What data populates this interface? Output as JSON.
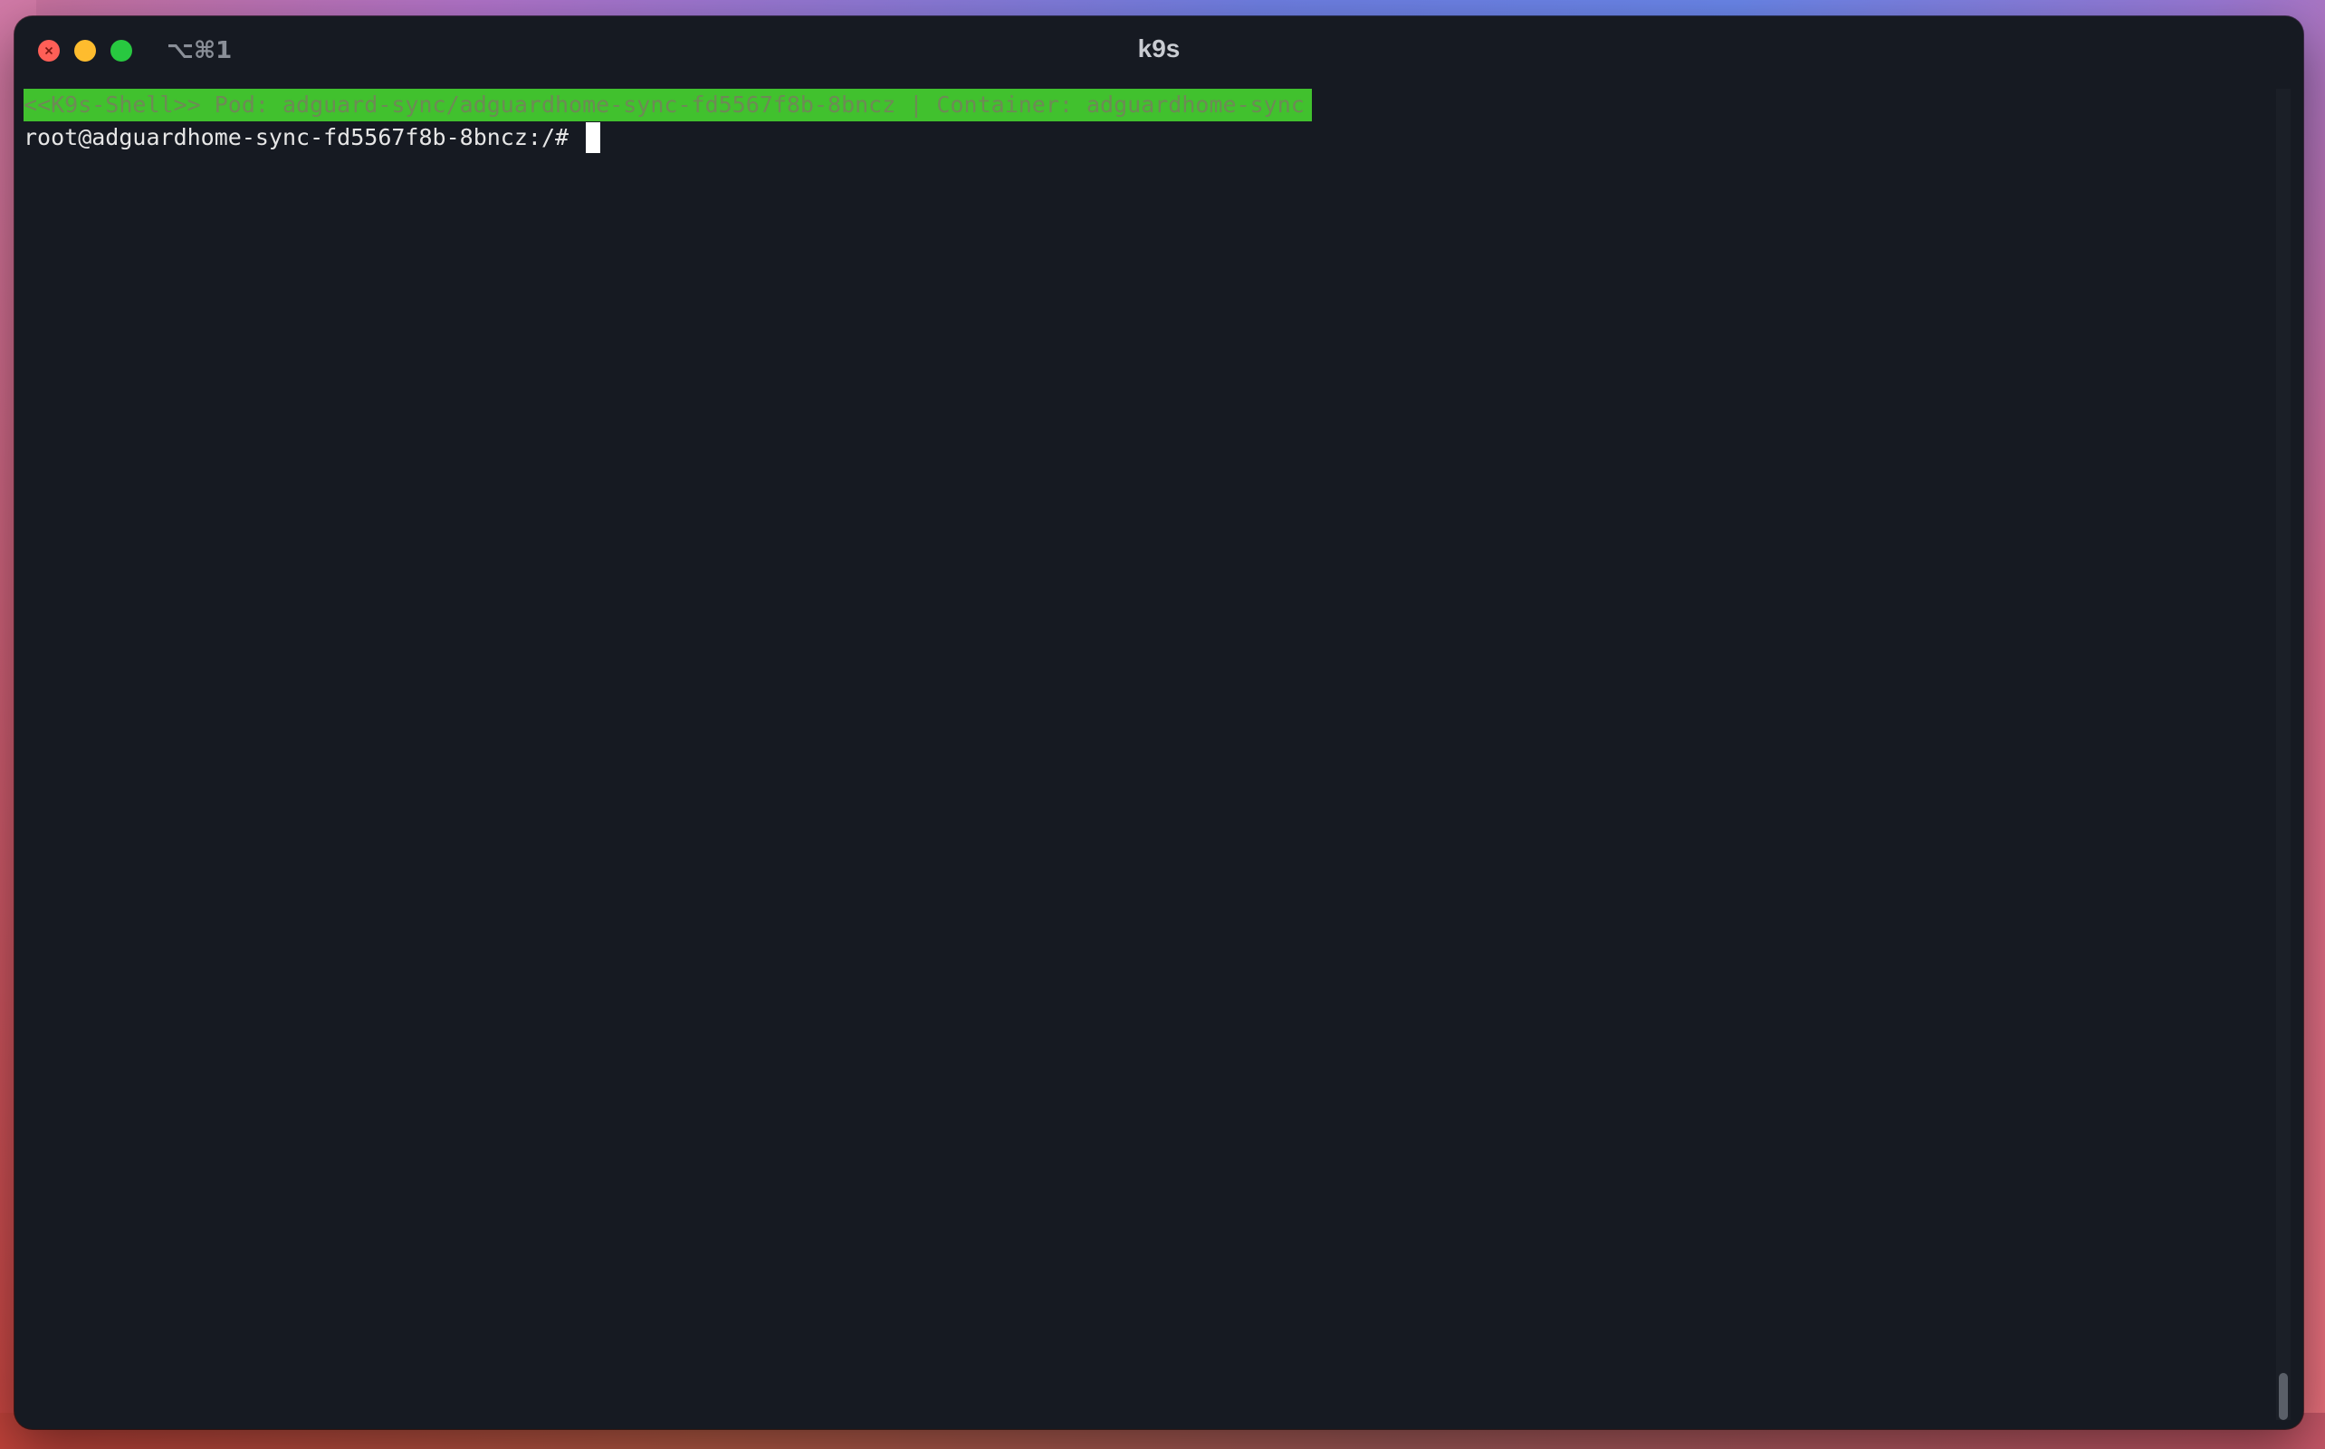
{
  "window": {
    "shortcut": "⌥⌘1",
    "title": "k9s"
  },
  "terminal": {
    "banner": "<<K9s-Shell>> Pod: adguard-sync/adguardhome-sync-fd5567f8b-8bncz | Container: adguardhome-sync",
    "prompt": "root@adguardhome-sync-fd5567f8b-8bncz:/# "
  },
  "colors": {
    "banner_bg": "#41c12e",
    "terminal_bg": "#161a22",
    "close": "#ff5f57",
    "minimize": "#febc2e",
    "maximize": "#28c840"
  },
  "icons": {
    "close": "close-icon",
    "minimize": "minimize-icon",
    "maximize": "maximize-icon"
  }
}
